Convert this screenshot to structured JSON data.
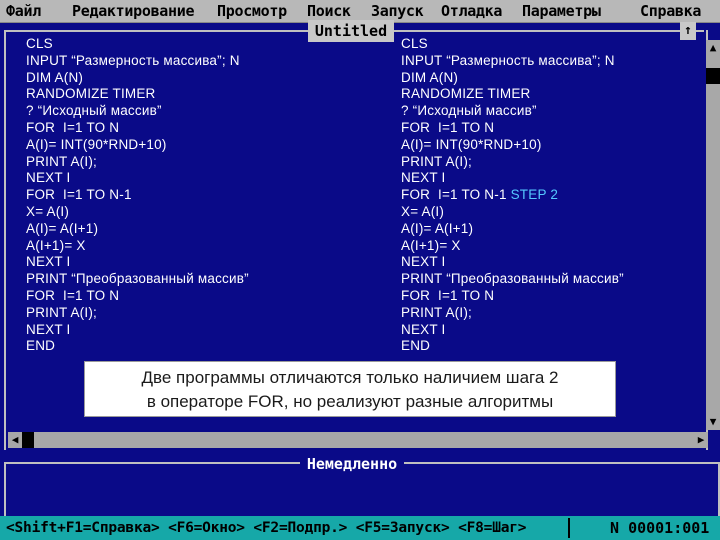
{
  "menu": [
    "Файл",
    "Редактирование",
    "Просмотр",
    "Поиск",
    "Запуск",
    "Отладка",
    "Параметры",
    "Справка"
  ],
  "window": {
    "title": "Untitled",
    "corner_button": "↑"
  },
  "program_left": [
    "CLS",
    "INPUT “Размерность массива”; N",
    "DIM A(N)",
    "RANDOMIZE TIMER",
    "? “Исходный массив”",
    "FOR  I=1 TO N",
    "A(I)= INT(90*RND+10)",
    "PRINT A(I);",
    "NEXT I",
    "FOR  I=1 TO N-1",
    "X= A(I)",
    "A(I)= A(I+1)",
    "A(I+1)= X",
    "NEXT I",
    "PRINT “Преобразованный массив”",
    "FOR  I=1 TO N",
    "PRINT A(I);",
    "NEXT I",
    "END"
  ],
  "program_right": [
    "CLS",
    "INPUT “Размерность массива”; N",
    "DIM A(N)",
    "RANDOMIZE TIMER",
    "? “Исходный массив”",
    "FOR  I=1 TO N",
    "A(I)= INT(90*RND+10)",
    "PRINT A(I);",
    "NEXT I",
    "FOR  I=1 TO N-1",
    "X= A(I)",
    "A(I)= A(I+1)",
    "A(I+1)= X",
    "NEXT I",
    "PRINT “Преобразованный массив”",
    "FOR  I=1 TO N",
    "PRINT A(I);",
    "NEXT I",
    "END"
  ],
  "right_highlight": {
    "line": 9,
    "text": " STEP 2",
    "color": "#55c8ff"
  },
  "caption": {
    "line1": "Две программы отличаются только наличием шага 2",
    "line2": "в операторе FOR,  но реализуют разные алгоритмы"
  },
  "immediate_label": "Немедленно",
  "status": {
    "hints": "<Shift+F1=Справка> <F6=Окно> <F2=Подпр.> <F5=Запуск> <F8=Шаг>",
    "mode": "N",
    "position": "00001:001"
  },
  "colors": {
    "background": "#0a0a88",
    "menubar": "#b8b8b8",
    "statusbar": "#16a8a8",
    "accent": "#55c8ff"
  },
  "icons": {
    "scroll_up": "arrow-up",
    "scroll_down": "arrow-down",
    "scroll_left": "arrow-left",
    "scroll_right": "arrow-right"
  }
}
